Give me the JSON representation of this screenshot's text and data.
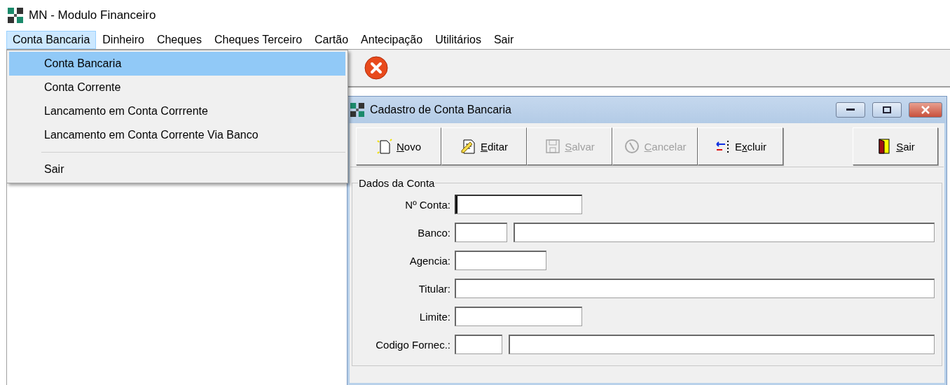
{
  "window": {
    "title": "MN - Modulo Financeiro"
  },
  "menubar": [
    {
      "label": "Conta Bancaria",
      "selected": true
    },
    {
      "label": "Dinheiro",
      "selected": false
    },
    {
      "label": "Cheques",
      "selected": false
    },
    {
      "label": "Cheques Terceiro",
      "selected": false
    },
    {
      "label": "Cartão",
      "selected": false
    },
    {
      "label": "Antecipação",
      "selected": false
    },
    {
      "label": "Utilitários",
      "selected": false
    },
    {
      "label": "Sair",
      "selected": false
    }
  ],
  "dropdown": [
    {
      "kind": "item",
      "label": "Conta Bancaria",
      "selected": true
    },
    {
      "kind": "item",
      "label": "Conta Corrente",
      "selected": false
    },
    {
      "kind": "item",
      "label": "Lancamento em Conta Corrrente",
      "selected": false
    },
    {
      "kind": "item",
      "label": "Lancamento em Conta Corrente Via Banco",
      "selected": false
    },
    {
      "kind": "separator"
    },
    {
      "kind": "item",
      "label": "Sair",
      "selected": false
    }
  ],
  "child_window": {
    "title": "Cadastro de Conta Bancaria",
    "buttons": [
      {
        "kind": "new",
        "key": "N",
        "after": "ovo",
        "disabled": false
      },
      {
        "kind": "edit",
        "key": "E",
        "after": "ditar",
        "disabled": false
      },
      {
        "kind": "save",
        "key": "S",
        "after": "alvar",
        "disabled": true
      },
      {
        "kind": "cancel",
        "key": "C",
        "after": "ancelar",
        "disabled": true
      },
      {
        "kind": "delete",
        "before": "E",
        "key": "x",
        "after": "cluir",
        "disabled": false
      },
      {
        "kind": "exit",
        "key": "S",
        "after": "air",
        "disabled": false
      }
    ],
    "group": {
      "title": "Dados da Conta",
      "fields": [
        {
          "label": "Nº Conta:",
          "kind": "medium",
          "focused": true
        },
        {
          "label": "Banco:",
          "kind": "code-name",
          "focused": false
        },
        {
          "label": "Agencia:",
          "kind": "short",
          "focused": false
        },
        {
          "label": "Titular:",
          "kind": "wide",
          "focused": false
        },
        {
          "label": "Limite:",
          "kind": "medium",
          "focused": false
        },
        {
          "label": "Codigo Fornec.:",
          "kind": "code-name-narrow",
          "focused": false
        }
      ]
    }
  }
}
